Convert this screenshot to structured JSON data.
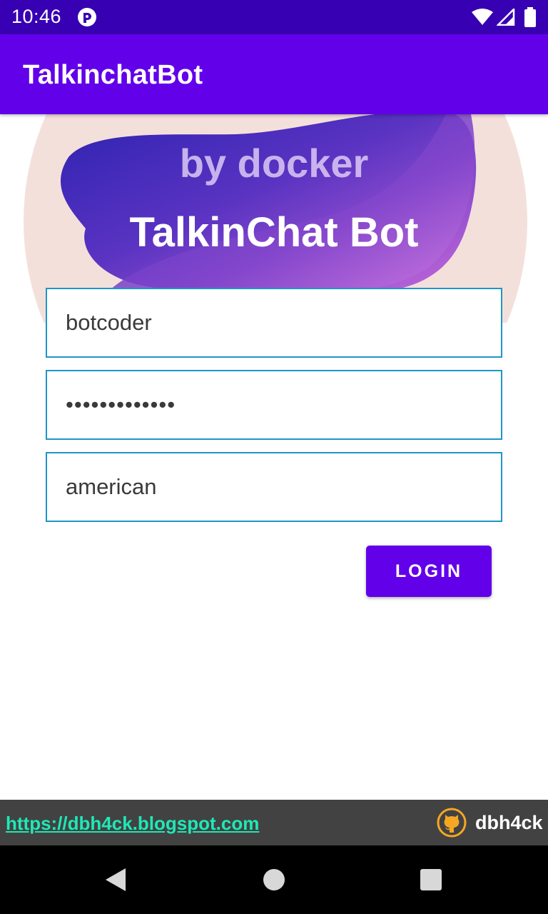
{
  "status_bar": {
    "time": "10:46",
    "icons": [
      "app-notification-icon",
      "wifi-icon",
      "signal-icon",
      "battery-icon"
    ]
  },
  "app_bar": {
    "title": "TalkinchatBot"
  },
  "banner": {
    "subtitle": "by docker",
    "title": "TalkinChat Bot",
    "colors": {
      "circle": "#f4e0db",
      "blob_dark": "#3124b5",
      "blob_light": "#c26ad9"
    }
  },
  "form": {
    "username": "botcoder",
    "password": "•••••••••••••",
    "language": "american",
    "login_label": "LOGIN"
  },
  "footer": {
    "link": "https://dbh4ck.blogspot.com",
    "github_user": "dbh4ck",
    "icon": "github-icon"
  },
  "navigation": {
    "icons": [
      "back-icon",
      "home-icon",
      "recents-icon"
    ]
  },
  "colors": {
    "status_bar": "#3700b3",
    "primary": "#6200ea",
    "field_border": "#1e96c8",
    "footer_bg": "#424242",
    "link": "#1de9b6",
    "github_orange": "#f5a623"
  }
}
